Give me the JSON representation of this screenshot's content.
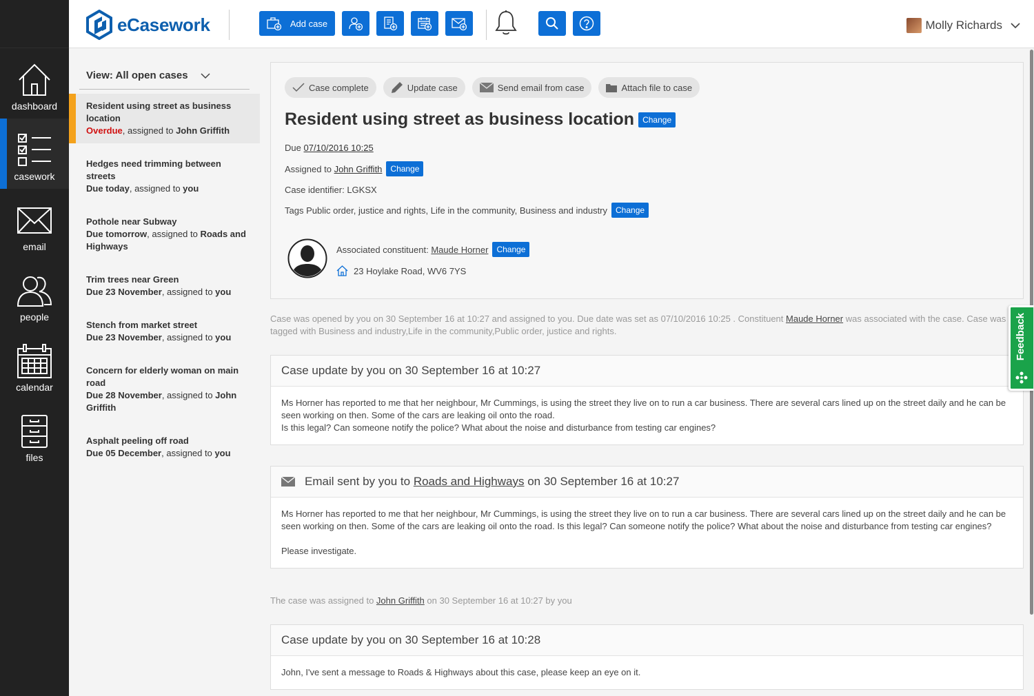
{
  "app": {
    "name": "eCasework"
  },
  "nav": {
    "items": [
      {
        "label": "dashboard",
        "icon": "house-icon"
      },
      {
        "label": "casework",
        "icon": "checklist-icon"
      },
      {
        "label": "email",
        "icon": "envelope-icon"
      },
      {
        "label": "people",
        "icon": "people-icon"
      },
      {
        "label": "calendar",
        "icon": "calendar-icon"
      },
      {
        "label": "files",
        "icon": "filing-cabinet-icon"
      }
    ],
    "active": "casework"
  },
  "toolbar": {
    "add_case_label": "Add case",
    "buttons": [
      "add-person-icon",
      "add-document-icon",
      "add-calendar-icon",
      "add-email-icon"
    ],
    "accent": "#0d6fd6"
  },
  "user": {
    "name": "Molly Richards"
  },
  "case_list": {
    "view_label": "View: All open cases",
    "items": [
      {
        "title": "Resident using street as business location",
        "due": "Overdue",
        "assigned_prefix": ", assigned to ",
        "assignee": "John Griffith"
      },
      {
        "title": "Hedges need trimming between streets",
        "due": "Due today",
        "assigned_prefix": ", assigned to ",
        "assignee": "you"
      },
      {
        "title": "Pothole near Subway",
        "due": "Due tomorrow",
        "assigned_prefix": ", assigned to ",
        "assignee": "Roads and Highways"
      },
      {
        "title": "Trim trees near Green",
        "due": "Due 23 November",
        "assigned_prefix": ", assigned to ",
        "assignee": "you"
      },
      {
        "title": "Stench from market street",
        "due": "Due 23 November",
        "assigned_prefix": ", assigned to ",
        "assignee": "you"
      },
      {
        "title": "Concern for elderly woman on main road",
        "due": "Due 28 November",
        "assigned_prefix": ", assigned to ",
        "assignee": "John Griffith"
      },
      {
        "title": "Asphalt peeling off road",
        "due": "Due 05 December",
        "assigned_prefix": ", assigned to ",
        "assignee": "you"
      }
    ]
  },
  "case": {
    "actions": [
      "Case complete",
      "Update case",
      "Send email from case",
      "Attach file to case"
    ],
    "title": "Resident using street as business location",
    "change_label": "Change",
    "due_label": "Due",
    "due_value": "07/10/2016 10:25",
    "assigned_label": "Assigned to",
    "assigned_value": "John Griffith",
    "identifier": "Case identifier: LGKSX",
    "tags_label": "Tags",
    "tags_value": "Public order, justice and rights, Life in the community, Business and industry",
    "constituent_label": "Associated constituent:",
    "constituent_name": "Maude Horner",
    "address": "23 Hoylake Road, WV6 7YS"
  },
  "timeline": {
    "log1_a": "Case was opened by you on 30 September 16 at 10:27 and assigned to you. Due date was set as 07/10/2016 10:25 . Constituent ",
    "log1_link": "Maude Horner",
    "log1_b": " was associated with the case. Case was tagged with Business and industry,Life in the community,Public order, justice and rights.",
    "update1_header": "Case update by you on 30 September 16 at 10:27",
    "update1_body1": "Ms Horner has reported to me that her neighbour, Mr Cummings, is using the street they live on to run a car business. There are several cars lined up on the street daily and he can be seen working on then. Some of the cars are leaking oil onto the road.",
    "update1_body2": "Is this legal? Can someone notify the police? What about the noise and disturbance from testing car engines?",
    "email_header_a": "Email sent by you to ",
    "email_header_link": "Roads and Highways",
    "email_header_b": " on 30 September 16 at 10:27",
    "email_body1": "Ms Horner has reported to me that her neighbour, Mr Cummings, is using the street they live on to run a car business. There are several cars lined up on the street daily and he can be seen working on then. Some of the cars are leaking oil onto the road. Is this legal? Can someone notify the police? What about the noise and disturbance from testing car engines?",
    "email_body2": "Please investigate.",
    "log2_a": "The case was assigned to ",
    "log2_link": "John Griffith",
    "log2_b": " on 30 September 16 at 10:27 by you",
    "update2_header": "Case update by you on 30 September 16 at 10:28",
    "update2_body": "John, I've sent a message to Roads & Highways about this case, please keep an eye on it."
  },
  "feedback": {
    "label": "Feedback",
    "color": "#1aa34a"
  }
}
